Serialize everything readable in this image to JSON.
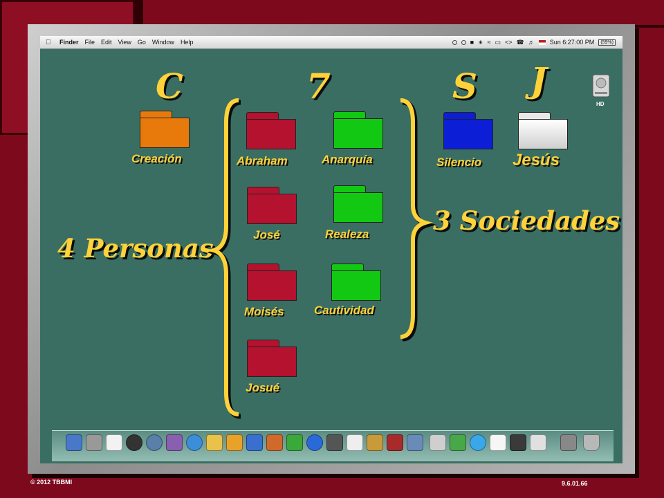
{
  "menubar": {
    "items": [
      "Finder",
      "File",
      "Edit",
      "View",
      "Go",
      "Window",
      "Help"
    ],
    "clock": "Sun 6:27:00 PM",
    "battery": "(59%)"
  },
  "headings": {
    "c": "C",
    "seven": "7",
    "s": "S",
    "j": "J"
  },
  "annotations": {
    "personas": "4 Personas",
    "sociedades": "3 Sociedades"
  },
  "folders": [
    {
      "label": "Creación",
      "color": "#e87a0c"
    },
    {
      "label": "Abraham",
      "color": "#b4122e"
    },
    {
      "label": "José",
      "color": "#b4122e"
    },
    {
      "label": "Moisés",
      "color": "#b4122e"
    },
    {
      "label": "Josué",
      "color": "#b4122e"
    },
    {
      "label": "Anarquía",
      "color": "#12c812"
    },
    {
      "label": "Realeza",
      "color": "#12c812"
    },
    {
      "label": "Cautividad",
      "color": "#12c812"
    },
    {
      "label": "Silencio",
      "color": "#0c1fd6"
    },
    {
      "label": "Jesús",
      "color": "#e8e8e8"
    }
  ],
  "hd": {
    "label": "HD"
  },
  "colors": {
    "accent_yellow": "#ffd23a",
    "desktop": "#3a6e63",
    "background": "#7d0a1c"
  },
  "footer": {
    "copyright": "© 2012 TBBMI",
    "code": "9.6.01.66"
  }
}
